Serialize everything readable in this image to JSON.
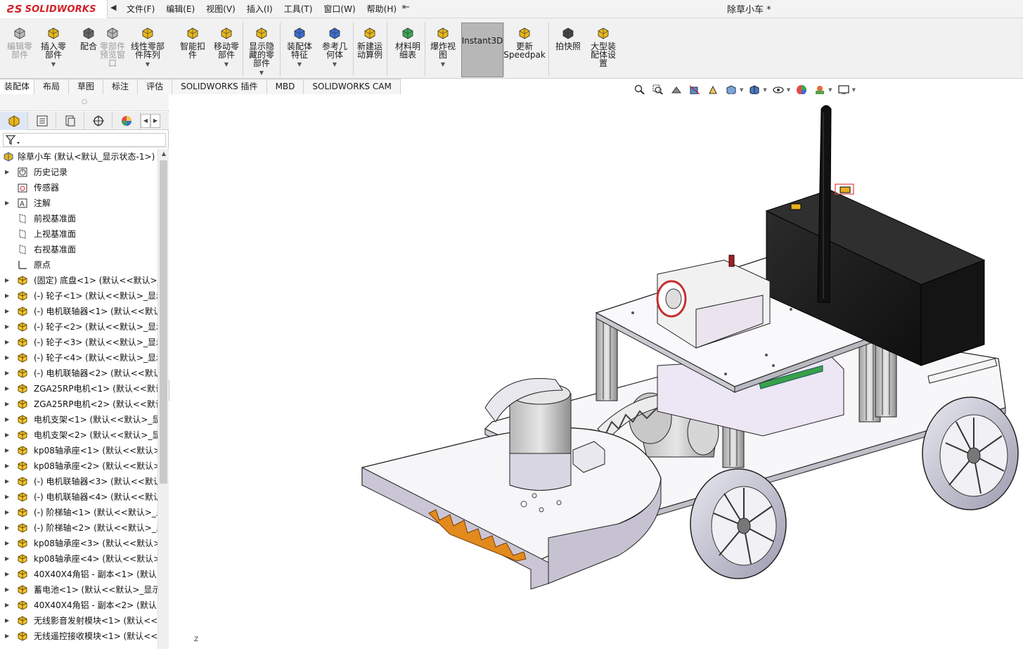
{
  "app": {
    "logo_prefix": "3S",
    "logo_text": "SOLIDWORKS",
    "window_title": "除草小车 *"
  },
  "menu": [
    "文件(F)",
    "编辑(E)",
    "视图(V)",
    "插入(I)",
    "工具(T)",
    "窗口(W)",
    "帮助(H)"
  ],
  "ribbon": {
    "buttons": [
      {
        "label": "编辑零\n部件",
        "icon": "edit-component-icon",
        "disabled": true
      },
      {
        "label": "插入零\n部件",
        "icon": "insert-component-icon",
        "disabled": false
      },
      {
        "label": "配合",
        "icon": "mate-icon",
        "disabled": false
      },
      {
        "label": "零部件\n预览窗\n口",
        "icon": "component-preview-icon",
        "disabled": true
      },
      {
        "label": "线性零部\n件阵列",
        "icon": "linear-pattern-icon",
        "disabled": false
      },
      {
        "label": "智能扣\n件",
        "icon": "smart-fasteners-icon",
        "disabled": false
      },
      {
        "label": "移动零\n部件",
        "icon": "move-component-icon",
        "disabled": false
      },
      {
        "label": "显示隐\n藏的零\n部件",
        "icon": "show-hidden-icon",
        "disabled": false
      },
      {
        "label": "装配体\n特征",
        "icon": "assembly-features-icon",
        "disabled": false
      },
      {
        "label": "参考几\n何体",
        "icon": "reference-geometry-icon",
        "disabled": false
      },
      {
        "label": "新建运\n动算例",
        "icon": "motion-study-icon",
        "disabled": false
      },
      {
        "label": "材料明\n细表",
        "icon": "bom-icon",
        "disabled": false
      },
      {
        "label": "爆炸视\n图",
        "icon": "exploded-view-icon",
        "disabled": false
      },
      {
        "label": "Instant3D",
        "icon": "instant3d-icon",
        "disabled": false
      },
      {
        "label": "更新\nSpeedpak",
        "icon": "speedpak-icon",
        "disabled": false
      },
      {
        "label": "拍快照",
        "icon": "snapshot-icon",
        "disabled": false
      },
      {
        "label": "大型装\n配体设\n置",
        "icon": "large-assembly-icon",
        "disabled": false
      }
    ]
  },
  "tabs": [
    "装配体",
    "布局",
    "草图",
    "标注",
    "评估",
    "SOLIDWORKS 插件",
    "MBD",
    "SOLIDWORKS CAM"
  ],
  "tree": {
    "root": "除草小车  (默认<默认_显示状态-1>)",
    "items": [
      {
        "label": "历史记录",
        "icon": "history-icon",
        "expandable": true
      },
      {
        "label": "传感器",
        "icon": "sensor-icon",
        "expandable": false
      },
      {
        "label": "注解",
        "icon": "annotation-icon",
        "expandable": true
      },
      {
        "label": "前视基准面",
        "icon": "plane-icon",
        "expandable": false
      },
      {
        "label": "上视基准面",
        "icon": "plane-icon",
        "expandable": false
      },
      {
        "label": "右视基准面",
        "icon": "plane-icon",
        "expandable": false
      },
      {
        "label": "原点",
        "icon": "origin-icon",
        "expandable": false
      },
      {
        "label": "(固定) 底盘<1> (默认<<默认>_",
        "icon": "part-icon",
        "expandable": true
      },
      {
        "label": "(-) 轮子<1> (默认<<默认>_显示",
        "icon": "part-icon",
        "expandable": true
      },
      {
        "label": "(-) 电机联轴器<1> (默认<<默认",
        "icon": "part-icon",
        "expandable": true
      },
      {
        "label": "(-) 轮子<2> (默认<<默认>_显示",
        "icon": "part-icon",
        "expandable": true
      },
      {
        "label": "(-) 轮子<3> (默认<<默认>_显示",
        "icon": "part-icon",
        "expandable": true
      },
      {
        "label": "(-) 轮子<4> (默认<<默认>_显示",
        "icon": "part-icon",
        "expandable": true
      },
      {
        "label": "(-) 电机联轴器<2> (默认<<默认",
        "icon": "part-icon",
        "expandable": true
      },
      {
        "label": "ZGA25RP电机<1> (默认<<默认",
        "icon": "part-icon",
        "expandable": true
      },
      {
        "label": "ZGA25RP电机<2> (默认<<默认",
        "icon": "part-icon",
        "expandable": true
      },
      {
        "label": "电机支架<1> (默认<<默认>_显",
        "icon": "part-icon",
        "expandable": true
      },
      {
        "label": "电机支架<2> (默认<<默认>_显",
        "icon": "part-icon",
        "expandable": true
      },
      {
        "label": "kp08轴承座<1> (默认<<默认>_",
        "icon": "part-icon",
        "expandable": true
      },
      {
        "label": "kp08轴承座<2> (默认<<默认>_",
        "icon": "part-icon",
        "expandable": true
      },
      {
        "label": "(-) 电机联轴器<3> (默认<<默认",
        "icon": "part-icon",
        "expandable": true
      },
      {
        "label": "(-) 电机联轴器<4> (默认<<默认",
        "icon": "part-icon",
        "expandable": true
      },
      {
        "label": "(-) 阶梯轴<1> (默认<<默认>_显",
        "icon": "part-icon",
        "expandable": true
      },
      {
        "label": "(-) 阶梯轴<2> (默认<<默认>_显",
        "icon": "part-icon",
        "expandable": true
      },
      {
        "label": "kp08轴承座<3> (默认<<默认>_",
        "icon": "part-icon",
        "expandable": true
      },
      {
        "label": "kp08轴承座<4> (默认<<默认>_",
        "icon": "part-icon",
        "expandable": true
      },
      {
        "label": "40X40X4角铝 - 副本<1> (默认<",
        "icon": "part-icon",
        "expandable": true
      },
      {
        "label": "蓄电池<1> (默认<<默认>_显示",
        "icon": "part-icon",
        "expandable": true
      },
      {
        "label": "40X40X4角铝 - 副本<2> (默认<",
        "icon": "part-icon",
        "expandable": true
      },
      {
        "label": "无线影音发射模块<1> (默认<<默",
        "icon": "part-icon",
        "expandable": true
      },
      {
        "label": "无线遥控接收模块<1> (默认<<默",
        "icon": "part-icon",
        "expandable": true
      }
    ]
  },
  "viewport": {
    "triad_label": "Z"
  },
  "colors": {
    "brand": "#d4212a",
    "part_icon": "#e8b71a",
    "ribbon_bg": "#f1f1f1",
    "selected_button": "#b7b7b7"
  }
}
